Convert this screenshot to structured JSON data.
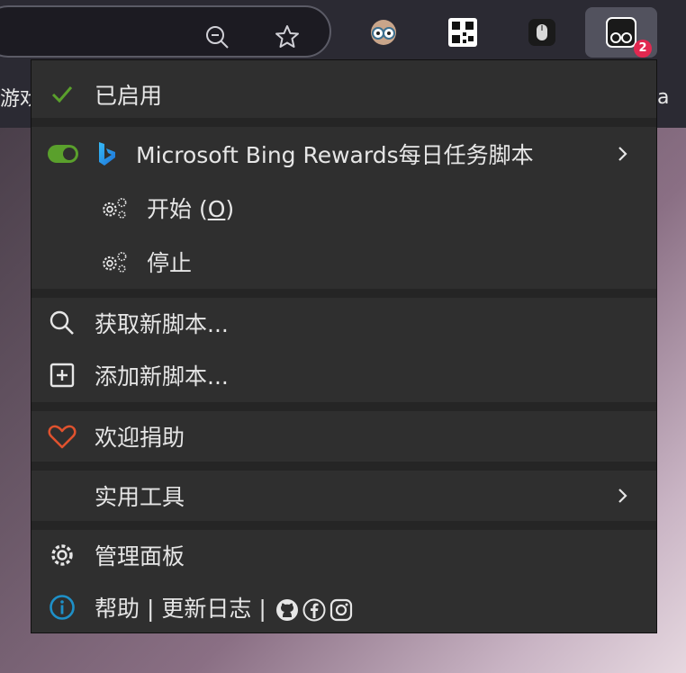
{
  "browser": {
    "extension_badge": "2",
    "bookmark_left_text": "游戏",
    "bookmark_right_text": "a"
  },
  "menu": {
    "enabled_label": "已启用",
    "script": {
      "name": "Microsoft Bing Rewards每日任务脚本",
      "commands": [
        {
          "label": "开始 (",
          "accesskey": "O",
          "suffix": ")"
        },
        {
          "label": "停止"
        }
      ]
    },
    "get_scripts_label": "获取新脚本...",
    "add_script_label": "添加新脚本...",
    "donate_label": "欢迎捐助",
    "utilities_label": "实用工具",
    "dashboard_label": "管理面板",
    "help_label": "帮助",
    "divider": "|",
    "changelog_label": "更新日志"
  },
  "colors": {
    "accent_green": "#5aa02c",
    "heart": "#e0522e",
    "info": "#1e90c8",
    "badge": "#e22850"
  }
}
